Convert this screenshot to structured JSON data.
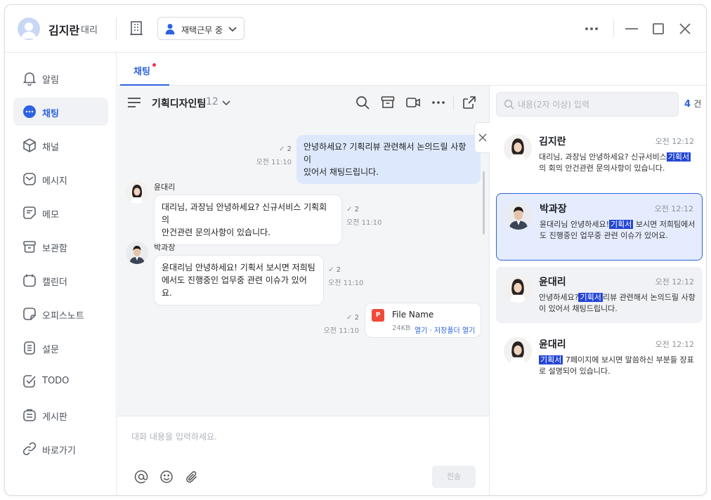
{
  "header": {
    "user_name": "김지란",
    "user_rank": "대리",
    "status": "재택근무 중"
  },
  "sidebar": {
    "items": [
      {
        "label": "알림",
        "icon": "bell-icon"
      },
      {
        "label": "채팅",
        "icon": "chat-icon"
      },
      {
        "label": "채널",
        "icon": "cube-icon"
      },
      {
        "label": "메시지",
        "icon": "mail-icon"
      },
      {
        "label": "메모",
        "icon": "memo-icon"
      },
      {
        "label": "보관함",
        "icon": "archive-icon"
      },
      {
        "label": "캘린더",
        "icon": "calendar-icon"
      },
      {
        "label": "오피스노트",
        "icon": "note-icon"
      },
      {
        "label": "설문",
        "icon": "survey-icon"
      },
      {
        "label": "TODO",
        "icon": "check-circle-icon"
      },
      {
        "label": "게시판",
        "icon": "board-icon"
      },
      {
        "label": "바로가기",
        "icon": "link-icon"
      }
    ],
    "active_index": 1
  },
  "tabs": [
    {
      "label": "채팅",
      "has_dot": true
    }
  ],
  "chat": {
    "room_title": "기획디자인팀",
    "member_count": "12",
    "messages": [
      {
        "type": "mine",
        "text_lines": [
          "안녕하세요? 기획리뷰 관련해서 논의드릴 사항이",
          "있어서 채팅드립니다."
        ],
        "unread": "2",
        "time": "오전 11:10"
      },
      {
        "type": "other",
        "sender": "윤대리",
        "text_lines": [
          "대리님, 과장님 안녕하세요? 신규서비스 기획회의",
          "안건관련 문의사항이 있습니다."
        ],
        "unread": "2",
        "time": "오전 11:10"
      },
      {
        "type": "other",
        "sender": "박과장",
        "text_lines": [
          "윤대리님 안녕하세요! 기획서 보시면 저희팀",
          "에서도 진행중인 업무중 관련 이슈가 있어요."
        ],
        "unread": "2",
        "time": "오전 11:10"
      },
      {
        "type": "file",
        "file_badge": "P",
        "file_name": "File Name",
        "file_size": "24KB",
        "file_links": "열기 · 저장폴더 열기",
        "unread": "2",
        "time": "오전 11:10"
      }
    ],
    "composer_placeholder": "대화 내용을 입력하세요.",
    "send_label": "전송"
  },
  "search_panel": {
    "placeholder": "내용(2자 이상) 입력",
    "count": "4",
    "count_unit": "건",
    "keyword": "기획서",
    "results": [
      {
        "name": "김지란",
        "time": "오전 12:12",
        "pre": "대리님, 과장님 안녕하세요? 신규서비스",
        "hit": "기획서",
        "post": "의 회의 안건관련 문의사항이 있습니다."
      },
      {
        "name": "박과장",
        "time": "오전 12:12",
        "pre": "윤대리님 안녕하세요!",
        "hit": "기획서",
        "post": " 보시면 저희팀에서도 진행중인 업무중 관련 이슈가 있어요."
      },
      {
        "name": "윤대리",
        "time": "오전 12:12",
        "pre": "안녕하세요?",
        "hit": "기획서",
        "post": "리뷰 관련해서 논의드릴 사항이 있어서 채팅드립니다."
      },
      {
        "name": "윤대리",
        "time": "오전 12:12",
        "pre": "",
        "hit": "기획서",
        "post": " 7페이지에 보시면 말씀하신 부분들 장표로 설명되어 있습니다."
      }
    ],
    "selected_index": 1
  },
  "colors": {
    "accent": "#2d63e0",
    "highlight": "#2446d4",
    "my_bubble": "#dde8fc",
    "chat_bg": "#f4f5f7",
    "notification_dot": "#f0334a"
  }
}
